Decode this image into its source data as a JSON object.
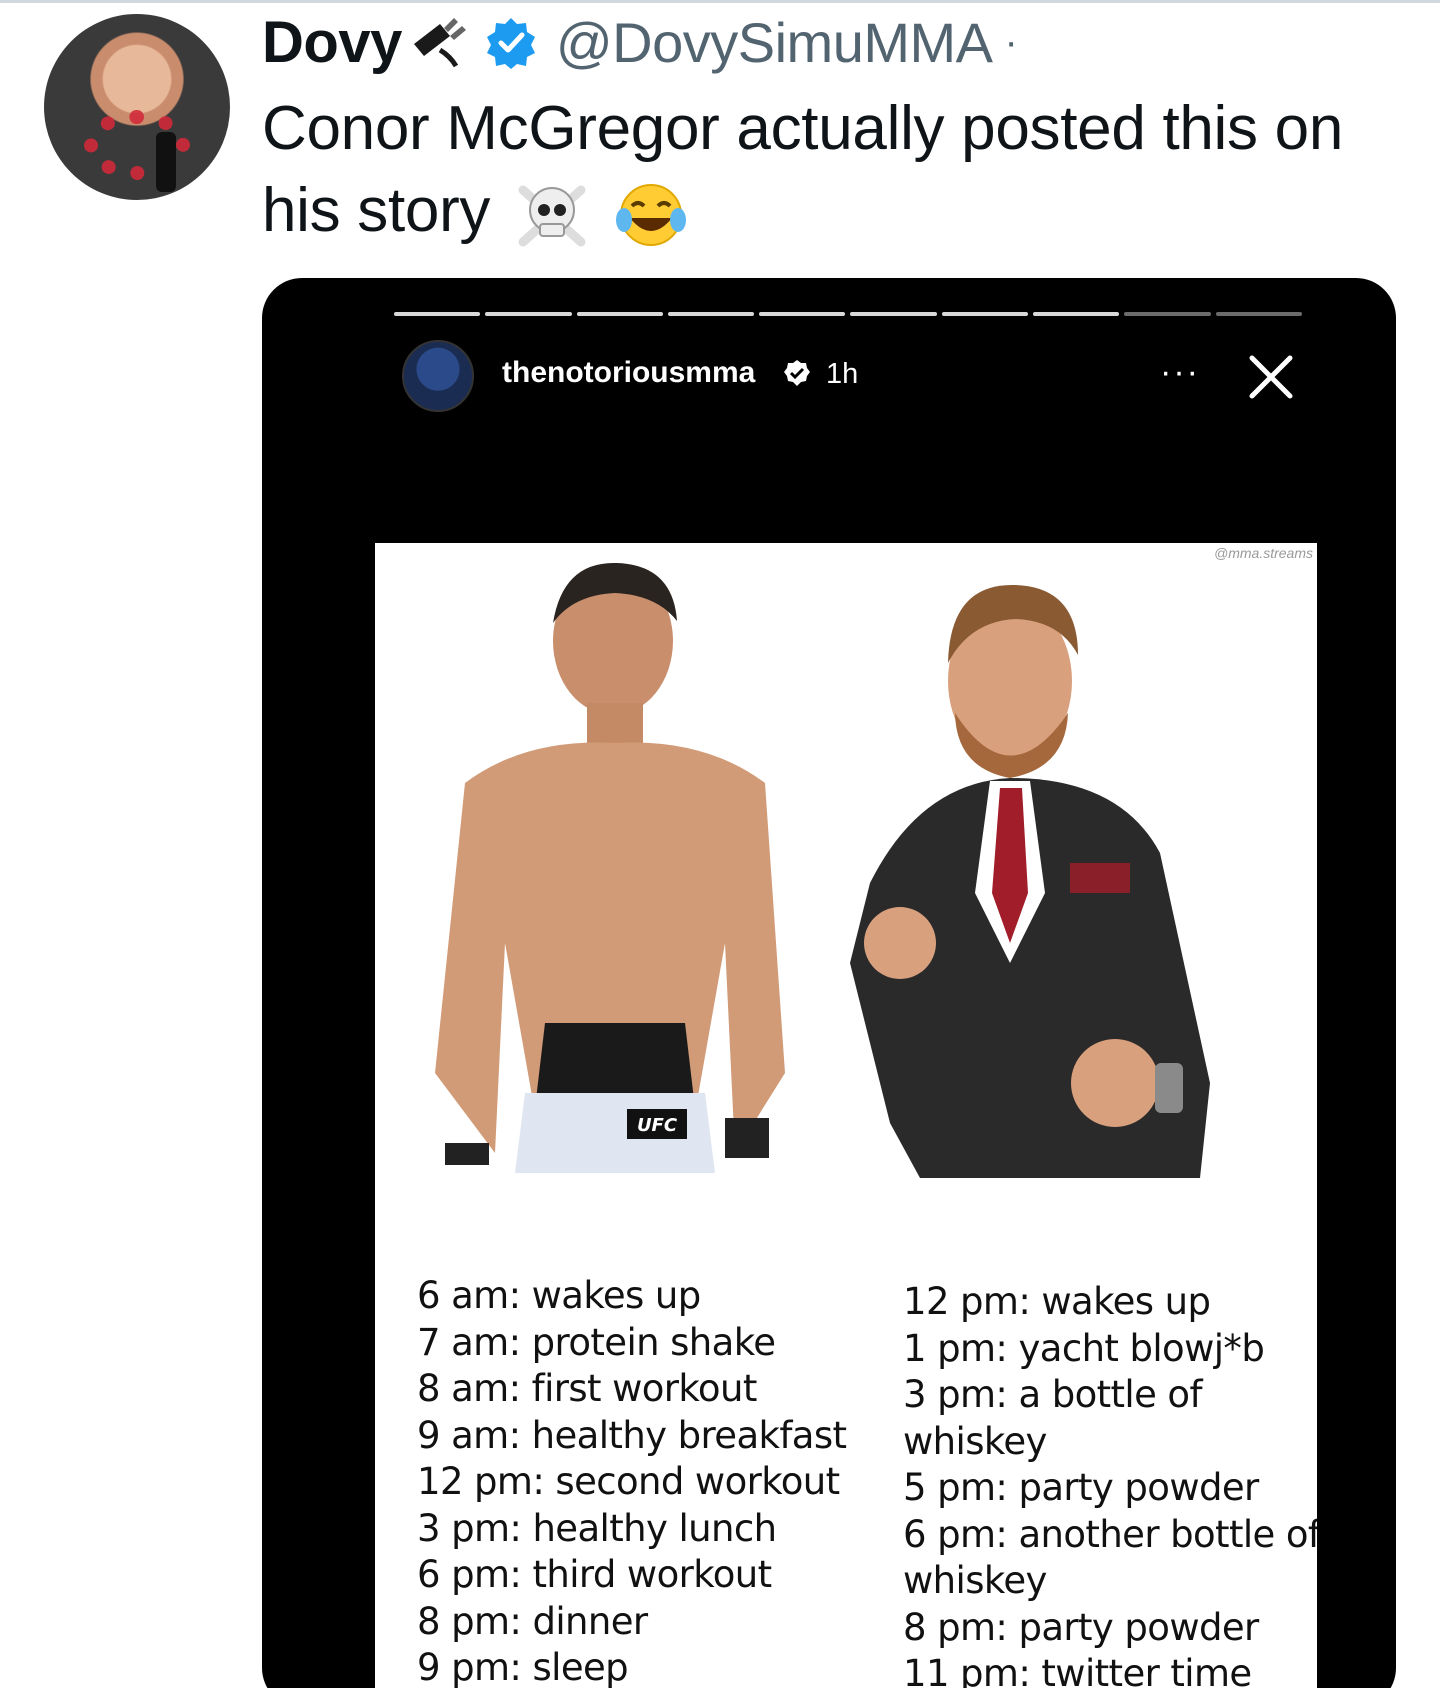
{
  "tweet": {
    "display_name": "Dovy",
    "handle": "@DovySimuMMA",
    "separator": "·",
    "text": "Conor McGregor actually posted this on his story",
    "emojis": [
      "skull-and-crossbones",
      "face-with-tears-of-joy"
    ]
  },
  "story": {
    "username": "thenotoriousmma",
    "time": "1h",
    "more_label": "···",
    "progress_segments": 10,
    "active_segments": 8
  },
  "meme": {
    "watermark": "@mma.streams",
    "trunks_logo": "UFC",
    "left_schedule": [
      "6 am: wakes up",
      "7 am: protein shake",
      "8 am: first workout",
      "9 am: healthy breakfast",
      "12 pm: second workout",
      "3 pm: healthy lunch",
      "6 pm: third workout",
      "8 pm: dinner",
      "9 pm: sleep"
    ],
    "right_schedule": [
      "12 pm: wakes up",
      "1 pm: yacht blowj*b",
      "3 pm: a bottle of",
      "whiskey",
      "5 pm: party powder",
      "6 pm: another bottle of",
      "whiskey",
      "8 pm: party powder",
      "11 pm: twitter time"
    ]
  },
  "colors": {
    "verified_blue": "#1d9bf0",
    "handle_gray": "#536471",
    "text": "#0f1419"
  }
}
